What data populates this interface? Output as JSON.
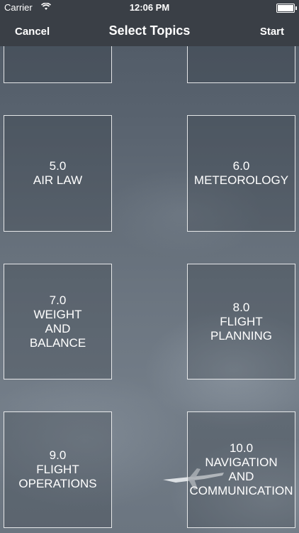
{
  "status": {
    "carrier": "Carrier",
    "time": "12:06 PM"
  },
  "nav": {
    "cancel": "Cancel",
    "title": "Select Topics",
    "start": "Start"
  },
  "topics": [
    {
      "number": "5.0",
      "name": "AIR LAW"
    },
    {
      "number": "6.0",
      "name": "METEOROLOGY"
    },
    {
      "number": "7.0",
      "name": "WEIGHT\nAND\nBALANCE"
    },
    {
      "number": "8.0",
      "name": "FLIGHT\nPLANNING"
    },
    {
      "number": "9.0",
      "name": "FLIGHT\nOPERATIONS"
    },
    {
      "number": "10.0",
      "name": "NAVIGATION\nAND\nCOMMUNICATION"
    }
  ]
}
